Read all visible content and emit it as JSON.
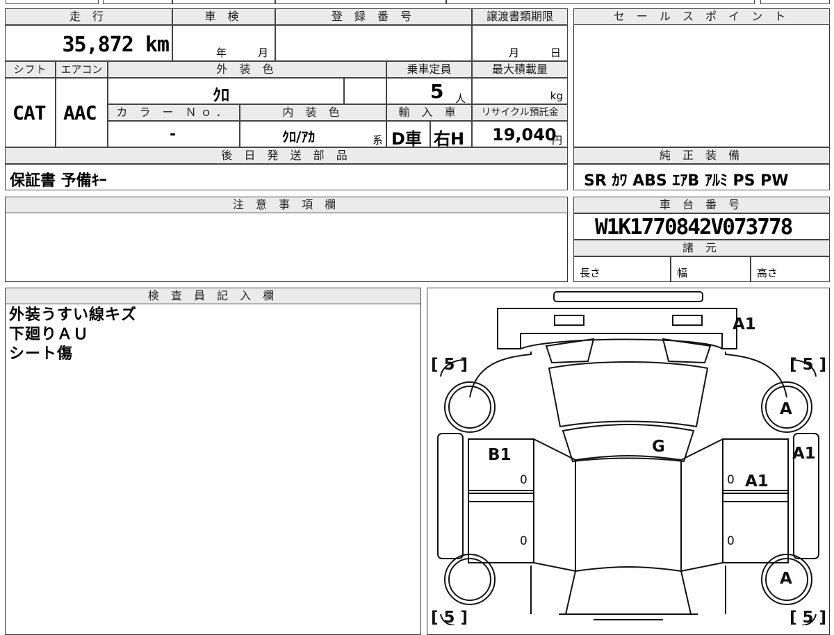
{
  "mileage": {
    "header": "走 行",
    "value": "35,872 km"
  },
  "shaken": {
    "header": "車 検",
    "year_label": "年",
    "month_label": "月"
  },
  "registration": {
    "header": "登 録 番 号"
  },
  "transfer": {
    "header": "譲渡書類期限",
    "month_label": "月",
    "day_label": "日"
  },
  "sale_points": {
    "header": "セ ー ル ス ポ イ ン ト"
  },
  "shift": {
    "header": "シフト",
    "value": "CAT"
  },
  "aircon": {
    "header": "エアコン",
    "value": "AAC"
  },
  "exterior_color": {
    "header": "外 装 色",
    "value": "ｸﾛ"
  },
  "capacity": {
    "header": "乗車定員",
    "value": "5",
    "unit": "人"
  },
  "max_load": {
    "header": "最大積載量",
    "unit": "kg"
  },
  "color_no": {
    "header": "カ ラ ー Ｎｏ．",
    "value": "-"
  },
  "interior_color": {
    "header": "内 装 色",
    "value": "ｸﾛ/ｱｶ",
    "suffix": "系"
  },
  "import": {
    "header": "輸 入 車",
    "type": "D車",
    "steering": "右H"
  },
  "recycle": {
    "header": "リサイクル預託金",
    "value": "19,040",
    "unit": "円"
  },
  "later_parts": {
    "header": "後 日 発 送 部 品",
    "value": "保証書 予備ｷｰ"
  },
  "equipment": {
    "header": "純 正 装 備",
    "value": "SR ｶﾜ ABS ｴｱB ｱﾙﾐ PS PW"
  },
  "caution": {
    "header": "注 意 事 項 欄"
  },
  "chassis": {
    "header": "車 台 番 号",
    "value": "W1K1770842V073778"
  },
  "specs": {
    "header": "諸 元",
    "length": "長さ",
    "width": "幅",
    "height": "高さ"
  },
  "inspector": {
    "header": "検 査 員 記 入 欄",
    "notes": [
      "外装うすい線キズ",
      "下廻りＡＵ",
      "シート傷"
    ]
  },
  "diagram": {
    "tread_fl": "[ 5 ]",
    "tread_fr": "[ 5 ]",
    "tread_rl": "[ 5 ]",
    "tread_rr": "[ 5 ]",
    "rear_bumper": "A1",
    "wheel_rear_right": "A",
    "wheel_front_right": "A",
    "left_rear_door": "B1",
    "roof": "G",
    "right_quarter": "A1",
    "right_rear_door": "A1",
    "zero": "0"
  }
}
